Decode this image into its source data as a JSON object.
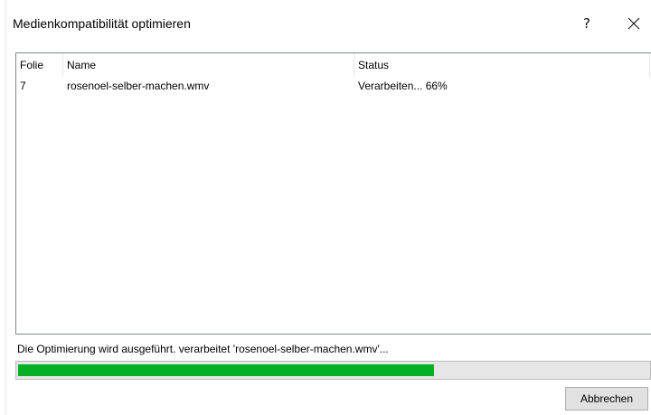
{
  "window": {
    "title": "Medienkompatibilität optimieren",
    "help_label": "?",
    "close_icon": "close-icon"
  },
  "table": {
    "columns": [
      "Folie",
      "Name",
      "Status"
    ],
    "rows": [
      {
        "folie": "7",
        "name": "rosenoel-selber-machen.wmv",
        "status": "Verarbeiten... 66%"
      }
    ]
  },
  "progress": {
    "message": "Die Optimierung wird ausgeführt. verarbeitet 'rosenoel-selber-machen.wmv'...",
    "fraction": 0.66,
    "color": "#06b025"
  },
  "buttons": {
    "cancel_label": "Abbrechen"
  }
}
